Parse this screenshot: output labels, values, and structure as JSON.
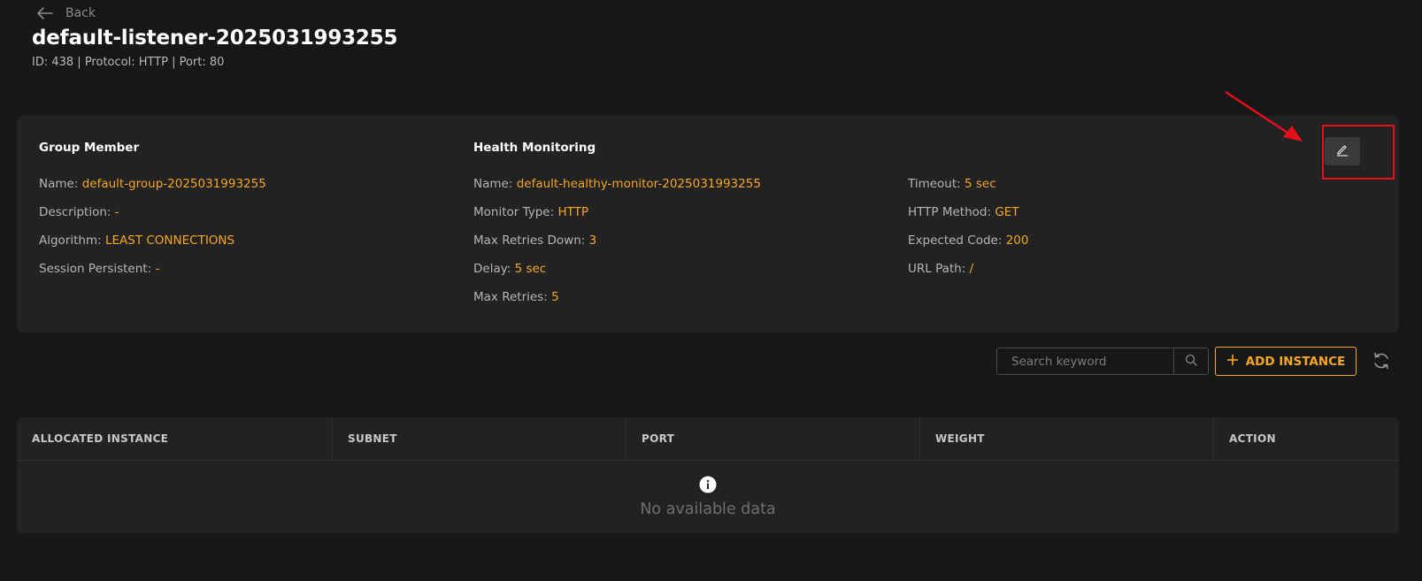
{
  "back_label": "Back",
  "title": "default-listener-2025031993255",
  "subtitle": "ID: 438 | Protocol: HTTP | Port: 80",
  "group_member": {
    "heading": "Group Member",
    "name_label": "Name:",
    "name_value": "default-group-2025031993255",
    "description_label": "Description:",
    "description_value": "-",
    "algorithm_label": "Algorithm:",
    "algorithm_value": "LEAST CONNECTIONS",
    "session_label": "Session Persistent:",
    "session_value": "-"
  },
  "health_monitoring": {
    "heading": "Health Monitoring",
    "name_label": "Name:",
    "name_value": "default-healthy-monitor-2025031993255",
    "type_label": "Monitor Type:",
    "type_value": "HTTP",
    "retries_down_label": "Max Retries Down:",
    "retries_down_value": "3",
    "delay_label": "Delay:",
    "delay_value": "5 sec",
    "max_retries_label": "Max Retries:",
    "max_retries_value": "5",
    "timeout_label": "Timeout:",
    "timeout_value": "5 sec",
    "method_label": "HTTP Method:",
    "method_value": "GET",
    "code_label": "Expected Code:",
    "code_value": "200",
    "url_label": "URL Path:",
    "url_value": "/"
  },
  "search": {
    "placeholder": "Search keyword",
    "value": ""
  },
  "add_instance_label": "ADD INSTANCE",
  "table": {
    "columns": [
      "ALLOCATED INSTANCE",
      "SUBNET",
      "PORT",
      "WEIGHT",
      "ACTION"
    ],
    "empty_text": "No available data"
  },
  "colors": {
    "background": "#171717",
    "card": "#222222",
    "accent": "#f5a623",
    "highlight": "#e3101b"
  },
  "icons": [
    "arrow-left-icon",
    "pencil-icon",
    "search-icon",
    "plus-icon",
    "refresh-icon",
    "info-icon"
  ]
}
